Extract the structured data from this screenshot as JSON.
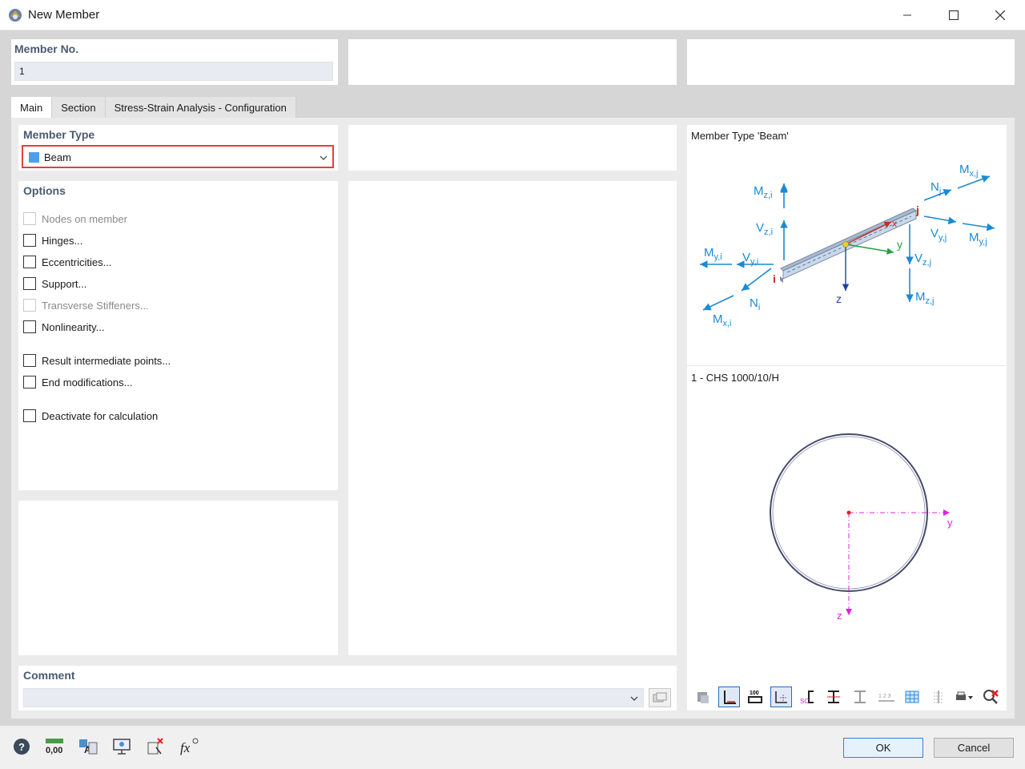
{
  "window": {
    "title": "New Member",
    "minimize": "—",
    "maximize": "☐",
    "close": "✕"
  },
  "header": {
    "member_no_label": "Member No.",
    "member_no_value": "1"
  },
  "tabs": [
    {
      "label": "Main"
    },
    {
      "label": "Section"
    },
    {
      "label": "Stress-Strain Analysis - Configuration"
    }
  ],
  "member_type": {
    "label": "Member Type",
    "selected": "Beam",
    "swatch_color": "#4aa0ea"
  },
  "options": {
    "label": "Options",
    "items": [
      {
        "label": "Nodes on member",
        "checked": false,
        "enabled": false
      },
      {
        "label": "Hinges...",
        "checked": false,
        "enabled": true
      },
      {
        "label": "Eccentricities...",
        "checked": false,
        "enabled": true
      },
      {
        "label": "Support...",
        "checked": false,
        "enabled": true
      },
      {
        "label": "Transverse Stiffeners...",
        "checked": false,
        "enabled": false
      },
      {
        "label": "Nonlinearity...",
        "checked": false,
        "enabled": true
      },
      {
        "label": "Result intermediate points...",
        "checked": false,
        "enabled": true
      },
      {
        "label": "End modifications...",
        "checked": false,
        "enabled": true
      },
      {
        "label": "Deactivate for calculation",
        "checked": false,
        "enabled": true
      }
    ]
  },
  "comment": {
    "label": "Comment",
    "value": ""
  },
  "preview": {
    "member_type_title": "Member Type 'Beam'",
    "section_title": "1 - CHS 1000/10/H",
    "diagram_labels": {
      "mzi": "Mz,i",
      "vzi": "Vz,i",
      "myi": "My,i",
      "vyi": "Vy,i",
      "ni": "Ni",
      "mxi": "Mx,i",
      "node_i": "i",
      "node_j": "j",
      "x": "x",
      "y": "y",
      "z": "z",
      "nj": "Nj",
      "mxj": "Mx,j",
      "vyj": "Vy,j",
      "myj": "My,j",
      "vzj": "Vz,j",
      "mzj": "Mz,j"
    },
    "section_axes": {
      "y": "y",
      "z": "z"
    }
  },
  "buttons": {
    "ok": "OK",
    "cancel": "Cancel"
  },
  "colors": {
    "accent_blue": "#1a8ad4",
    "highlight_red": "#e04040",
    "axis_magenta": "#e020e0"
  }
}
